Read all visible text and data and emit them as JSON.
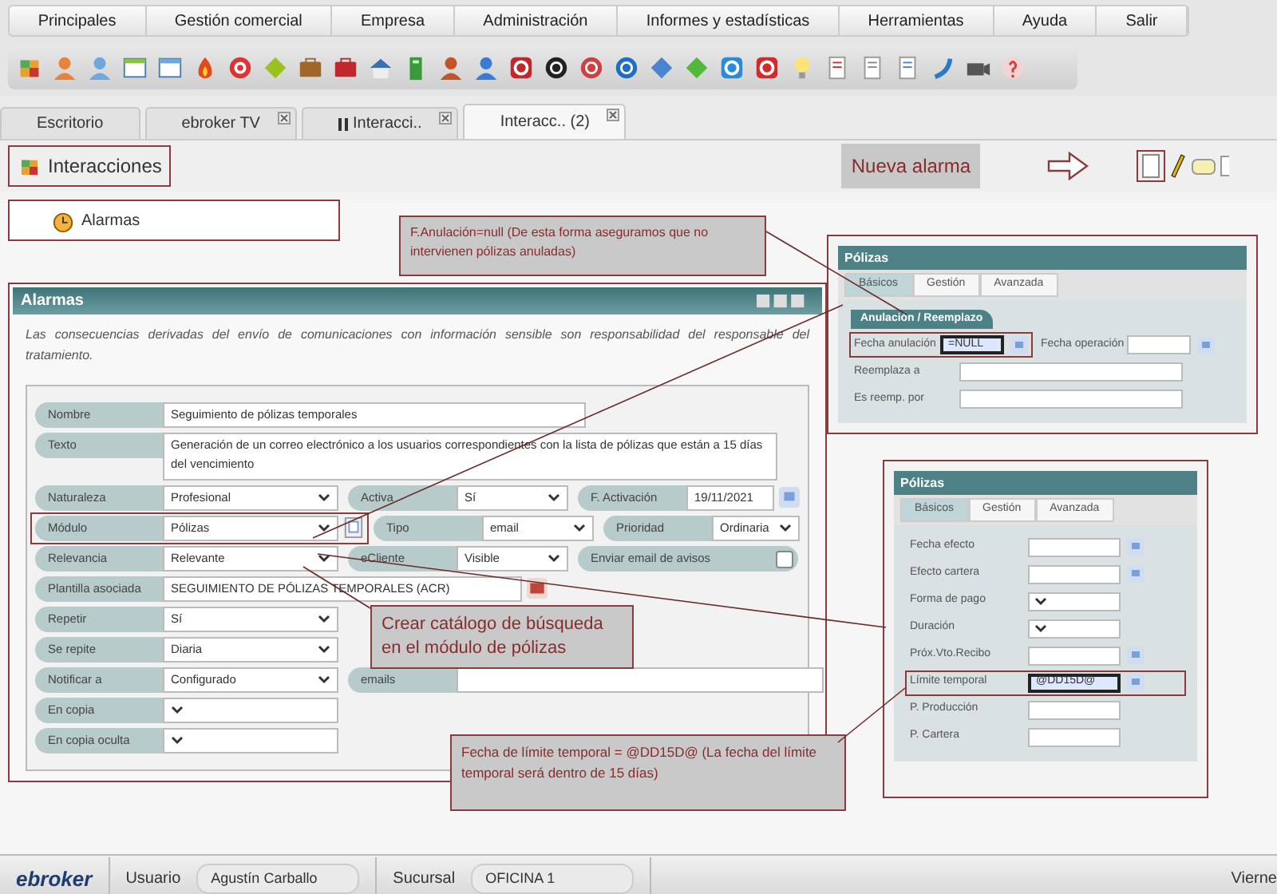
{
  "menu": [
    {
      "label": "Principales"
    },
    {
      "label": "Gestión comercial"
    },
    {
      "label": "Empresa"
    },
    {
      "label": "Administración"
    },
    {
      "label": "Informes y estadísticas"
    },
    {
      "label": "Herramientas"
    },
    {
      "label": "Ayuda"
    },
    {
      "label": "Salir"
    }
  ],
  "tabs": [
    {
      "label": "Escritorio",
      "selected": false,
      "closable": false,
      "paused": false
    },
    {
      "label": "ebroker TV",
      "selected": false,
      "closable": true,
      "paused": false
    },
    {
      "label": "Interacci..",
      "selected": false,
      "closable": true,
      "paused": true
    },
    {
      "label": "Interacc.. (2)",
      "selected": true,
      "closable": true,
      "paused": false
    }
  ],
  "module_header": {
    "title": "Interacciones",
    "hint": "Nueva alarma"
  },
  "sidebar_item": {
    "label": "Alarmas"
  },
  "alarm_panel": {
    "title": "Alarmas",
    "disclaimer": "Las consecuencias derivadas del envío de comunicaciones con información sensible son responsabilidad del responsable del tratamiento.",
    "rows": [
      [
        {
          "label": "Nombre",
          "kind": "text",
          "value": "Seguimiento de pólizas temporales"
        }
      ],
      [
        {
          "label": "Texto",
          "kind": "textarea",
          "value": "Generación de un correo electrónico a los usuarios correspondientes con la lista de pólizas que están a 15 días del vencimiento"
        }
      ],
      [
        {
          "label": "Naturaleza",
          "kind": "select",
          "value": "Profesional"
        },
        {
          "label": "Activa",
          "kind": "select",
          "value": "Sí"
        },
        {
          "label": "F. Activación",
          "kind": "date",
          "value": "19/11/2021"
        }
      ],
      [
        {
          "label": "Módulo",
          "kind": "select",
          "value": "Pólizas",
          "highlighted": true,
          "has_button": true
        },
        {
          "label": "Tipo",
          "kind": "select",
          "value": "email"
        },
        {
          "label": "Prioridad",
          "kind": "select",
          "value": "Ordinaria"
        }
      ],
      [
        {
          "label": "Relevancia",
          "kind": "select",
          "value": "Relevante"
        },
        {
          "label": "eCliente",
          "kind": "select",
          "value": "Visible"
        },
        {
          "label": "Enviar email de avisos",
          "kind": "checkbox",
          "checked": false
        }
      ],
      [
        {
          "label": "Plantilla asociada",
          "kind": "text",
          "value": "SEGUIMIENTO DE PÓLIZAS TEMPORALES (ACR)",
          "has_button": true
        }
      ],
      [
        {
          "label": "Repetir",
          "kind": "select",
          "value": "Sí"
        }
      ],
      [
        {
          "label": "Se repite",
          "kind": "select",
          "value": "Diaria"
        }
      ],
      [
        {
          "label": "Notificar a",
          "kind": "select",
          "value": "Configurado"
        },
        {
          "label": "emails",
          "kind": "text"
        }
      ],
      [
        {
          "label": "En copia",
          "kind": "select"
        }
      ],
      [
        {
          "label": "En copia oculta",
          "kind": "select"
        }
      ]
    ]
  },
  "cancel_panel": {
    "title": "Pólizas",
    "tabs": [
      {
        "label": "Básicos",
        "selected": true
      },
      {
        "label": "Gestión",
        "selected": false
      },
      {
        "label": "Avanzada",
        "selected": false
      }
    ],
    "section": "Anulación / Reemplazo",
    "fields": [
      {
        "label": "Fecha anulación",
        "kind": "date",
        "value": "=NULL",
        "highlighted": true
      },
      {
        "label": "Fecha operación",
        "kind": "date"
      },
      {
        "label": "Reemplaza a",
        "kind": "text"
      },
      {
        "label": "Es reemp. por",
        "kind": "text"
      }
    ]
  },
  "policy_panel": {
    "title": "Pólizas",
    "tabs": [
      {
        "label": "Básicos",
        "selected": true
      },
      {
        "label": "Gestión",
        "selected": false
      },
      {
        "label": "Avanzada",
        "selected": false
      }
    ],
    "fields": [
      {
        "label": "Fecha efecto",
        "kind": "date"
      },
      {
        "label": "Efecto cartera",
        "kind": "date"
      },
      {
        "label": "Forma de pago",
        "kind": "select"
      },
      {
        "label": "Duración",
        "kind": "select"
      },
      {
        "label": "Próx.Vto.Recibo",
        "kind": "date"
      },
      {
        "label": "Límite temporal",
        "kind": "date",
        "value": "@DD15D@",
        "highlighted": true
      },
      {
        "label": "P. Producción",
        "kind": "text"
      },
      {
        "label": "P. Cartera",
        "kind": "text"
      }
    ]
  },
  "notes": [
    {
      "text": "F.Anulación=null (De esta forma aseguramos que  no intervienen pólizas anuladas)"
    },
    {
      "text": "Crear catálogo de búsqueda en el módulo de pólizas"
    },
    {
      "text": "Fecha de límite temporal = @DD15D@ (La fecha del límite temporal será dentro de 15 días)"
    }
  ],
  "status_bar": {
    "logo": "ebroker",
    "user_label": "Usuario",
    "user": "Agustín Carballo",
    "branch_label": "Sucursal",
    "branch": "OFICINA 1",
    "date": "Vierne"
  }
}
